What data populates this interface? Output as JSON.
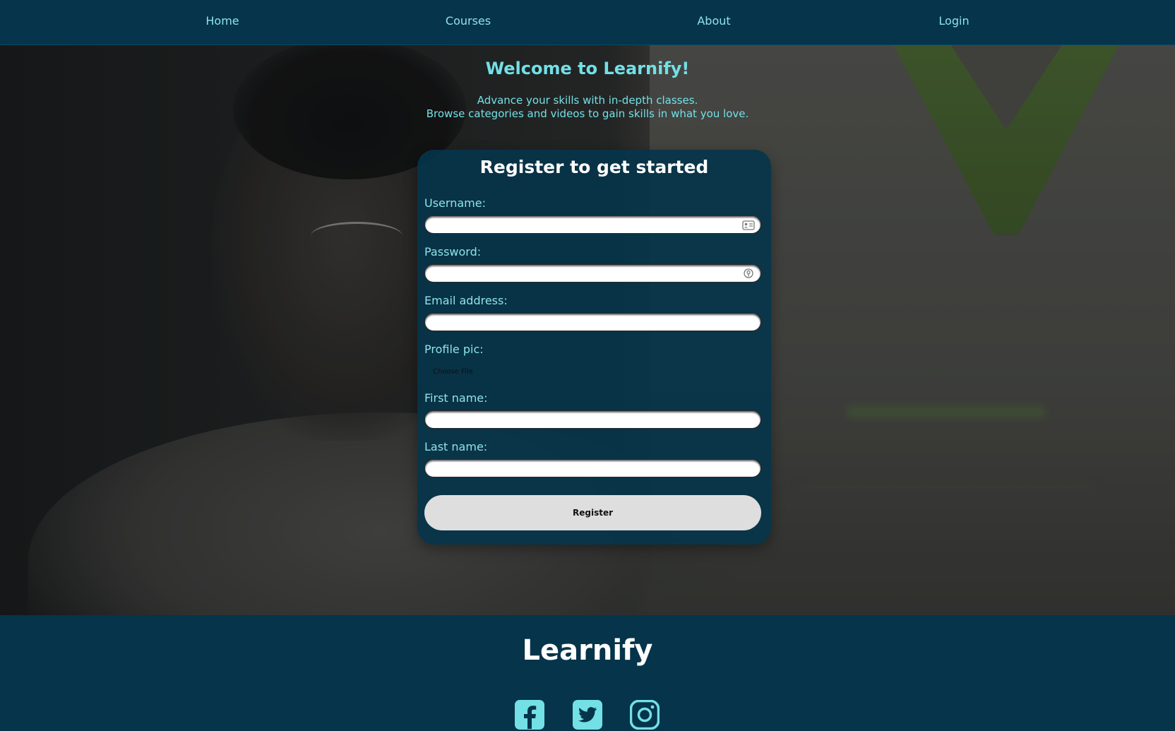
{
  "nav": {
    "items": [
      {
        "label": "Home"
      },
      {
        "label": "Courses"
      },
      {
        "label": "About"
      },
      {
        "label": "Login"
      }
    ]
  },
  "hero": {
    "title": "Welcome to Learnify!",
    "subtitle_line1": "Advance your skills with in-depth classes.",
    "subtitle_line2": "Browse categories and videos to gain skills in what you love."
  },
  "form": {
    "title": "Register to get started",
    "fields": [
      {
        "label": "Username:",
        "value": "",
        "icon": "contact-card-icon"
      },
      {
        "label": "Password:",
        "value": "",
        "icon": "password-key-icon"
      },
      {
        "label": "Email address:",
        "value": ""
      },
      {
        "label": "Profile pic:",
        "file_button": "Choose File"
      },
      {
        "label": "First name:",
        "value": ""
      },
      {
        "label": "Last name:",
        "value": ""
      }
    ],
    "submit_label": "Register"
  },
  "footer": {
    "brand": "Learnify",
    "social_icons": [
      "facebook-icon",
      "twitter-icon",
      "instagram-icon"
    ]
  },
  "colors": {
    "primary_dark": "#06344a",
    "accent_cyan": "#73e0e6",
    "nav_text": "#8ee3ea",
    "button_bg": "#dedede"
  }
}
